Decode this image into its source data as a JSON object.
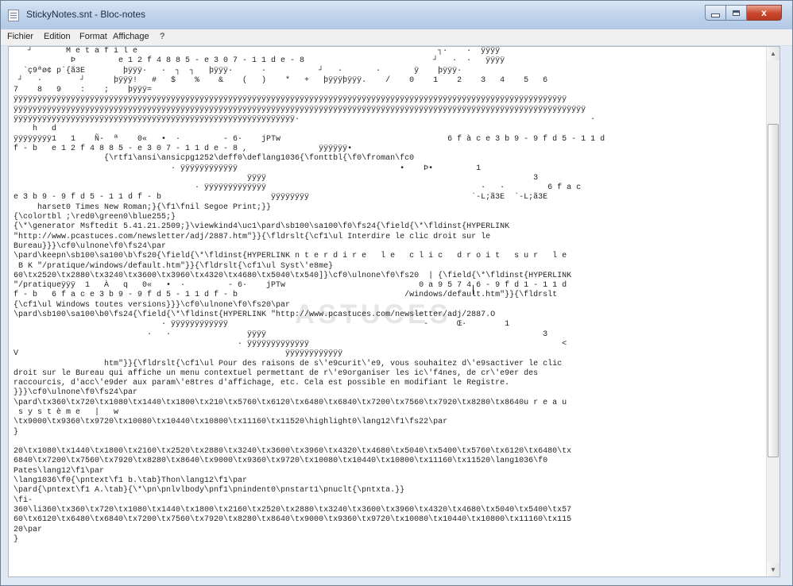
{
  "window": {
    "title": "StickyNotes.snt - Bloc-notes",
    "controls": {
      "minimize": "minimize",
      "maximize": "maximize",
      "close": "x"
    }
  },
  "menu": [
    "Fichier",
    "Edition",
    "Format",
    "Affichage",
    "?"
  ],
  "editor": {
    "watermark": "ASTUCES",
    "text": "   ┘       M e t a f i l e                                                               ┐·    ·  ÿÿÿÿ\n            Þ         e 1 2 f 4 8 8 5 - e 3 0 7 - 1 1 d e - 8                           ┘   ·  ·   ÿÿÿÿ\n  `ç9ªø¢ p`{ã3E        þÿÿÿ·   ·  ┐  ┐   þÿÿÿ·      ·           ┘   ·       ·       ÿ    þÿÿÿ·\n ┘   ·        ┘      þÿÿÿ!   #   $    %    &    (   )    *   +   þÿÿÿþÿÿÿ.    /    0    1    2    3   4    5   6\n7    8   9    :    ;    þÿÿÿ=\nÿÿÿÿÿÿÿÿÿÿÿÿÿÿÿÿÿÿÿÿÿÿÿÿÿÿÿÿÿÿÿÿÿÿÿÿÿÿÿÿÿÿÿÿÿÿÿÿÿÿÿÿÿÿÿÿÿÿÿÿÿÿÿÿÿÿÿÿÿÿÿÿÿÿÿÿÿÿÿÿÿÿÿÿÿÿÿÿÿÿÿÿÿÿÿÿÿÿÿÿÿÿÿÿÿÿÿÿÿÿÿÿÿÿÿÿ\nÿÿÿÿÿÿÿÿÿÿÿÿÿÿÿÿÿÿÿÿÿÿÿÿÿÿÿÿÿÿÿÿÿÿÿÿÿÿÿÿÿÿÿÿÿÿÿÿÿÿÿÿÿÿÿÿÿÿÿÿÿÿÿÿÿÿÿÿÿÿÿÿÿÿÿÿÿÿÿÿÿÿÿÿÿÿÿÿÿÿÿÿÿÿÿÿÿÿÿÿÿÿÿÿÿÿÿÿÿÿÿÿÿÿÿÿÿÿÿÿ\nÿÿÿÿÿÿÿÿÿÿÿÿÿÿÿÿÿÿÿÿÿÿÿÿÿÿÿÿÿÿÿÿÿÿÿÿÿÿÿÿÿÿÿÿÿÿÿÿÿÿÿÿÿÿÿÿÿÿÿ·                                                             ·\n    h   d\nÿÿÿÿÿÿÿÿ1   1    Ñ-  ª    0«   •  ·         - 6·    jPTw                                   6 f à c e 3 b 9 - 9 f d 5 - 1 1 d\nf - b   e 1 2 f 4 8 8 5 - e 3 0 7 - 1 1 d e - 8 ,               ÿÿÿÿÿÿ•\n                   {\\rtf1\\ansi\\ansicpg1252\\deff0\\deflang1036{\\fonttbl{\\f0\\froman\\fc0\n                                 · ÿÿÿÿÿÿÿÿÿÿÿÿ                                  •    Þ•         1\n                                                 ÿÿÿÿ                                                        3\n                                      · ÿÿÿÿÿÿÿÿÿÿÿÿÿ                                             ·   ·         6 f a c\ne 3 b 9 - 9 f d 5 - 1 1 d f - b                       ÿÿÿÿÿÿÿÿ                                  `-L;ã3E  `-L;ã3E\n     harset0 Times New Roman;}{\\f1\\fnil Segoe Print;}}\n{\\colortbl ;\\red0\\green0\\blue255;}\n{\\*\\generator Msftedit 5.41.21.2509;}\\viewkind4\\uc1\\pard\\sb100\\sa100\\f0\\fs24{\\field{\\*\\fldinst{HYPERLINK\n\"http://www.pcastuces.com/newsletter/adj/2887.htm\"}}{\\fldrslt{\\cf1\\ul Interdire le clic droit sur le\nBureau}}}\\cf0\\ulnone\\f0\\fs24\\par\n\\pard\\keepn\\sb100\\sa100\\b\\fs20{\\field{\\*\\fldinst{HYPERLINK n t e r d i r e   l e   c l i c   d r o i t   s u r   l e\n B K \"/pratique/windows/default.htm\"}}{\\fldrslt{\\cf1\\ul Syst\\'e8me}\n60\\tx2520\\tx2880\\tx3240\\tx3600\\tx3960\\tx4320\\tx4680\\tx5040\\tx540]}\\cf0\\ulnone\\f0\\fs20  | {\\field{\\*\\fldinst{HYPERLINK\n\"/pratiqueÿÿÿ  1   À   q   0«   •  ·         - 6·    jPTw                            0 a 9 5 7 4 6 - 9 f d 1 - 1 1 d\nf - b   6 f a c e 3 b 9 - 9 f d 5 - 1 1 d f - b                                   /windows/default.htm\"}}{\\fldrslt\n{\\cf1\\ul Windows toutes versions}}}\\cf0\\ulnone\\f0\\fs20\\par\n\\pard\\sb100\\sa100\\b0\\fs24{\\field{\\*\\fldinst{HYPERLINK \"http://www.pcastuces.com/newsletter/adj/2887.O\n                               · ÿÿÿÿÿÿÿÿÿÿÿÿ                                         -      Œ·        1\n                            ·   ·                ÿÿÿÿ                                                          3\n                                               · ÿÿÿÿÿÿÿÿÿÿÿÿÿ                                                     <\nV                                                        ÿÿÿÿÿÿÿÿÿÿÿÿ\n                   htm\"}}{\\fldrslt{\\cf1\\ul Pour des raisons de s\\'e9curit\\'e9, vous souhaitez d\\'e9sactiver le clic\ndroit sur le Bureau qui affiche un menu contextuel permettant de r\\'e9organiser les ic\\'f4nes, de cr\\'e9er des\nraccourcis, d'acc\\'e9der aux param\\'e8tres d'affichage, etc. Cela est possible en modifiant le Registre.\n}}}\\cf0\\ulnone\\f0\\fs24\\par\n\\pard\\tx360\\tx720\\tx1080\\tx1440\\tx1800\\tx210\\tx5760\\tx6120\\tx6480\\tx6840\\tx7200\\tx7560\\tx7920\\tx8280\\tx8640u r e a u\n s y s t è m e   |   w\n\\tx9000\\tx9360\\tx9720\\tx10080\\tx10440\\tx10800\\tx11160\\tx11520\\highlight0\\lang12\\f1\\fs22\\par\n}\n\n20\\tx1080\\tx1440\\tx1800\\tx2160\\tx2520\\tx2880\\tx3240\\tx3600\\tx3960\\tx4320\\tx4680\\tx5040\\tx5400\\tx5760\\tx6120\\tx6480\\tx\n6840\\tx7200\\tx7560\\tx7920\\tx8280\\tx8640\\tx9000\\tx9360\\tx9720\\tx10080\\tx10440\\tx10800\\tx11160\\tx11520\\lang1036\\f0\nPates\\lang12\\f1\\par\n\\lang1036\\f0{\\pntext\\f1 b.\\tab}Thon\\lang12\\f1\\par\n\\pard{\\pntext\\f1 A.\\tab}{\\*\\pn\\pnlvlbody\\pnf1\\pnindent0\\pnstart1\\pnuclt{\\pntxta.}}\n\\fi-\n360\\li360\\tx360\\tx720\\tx1080\\tx1440\\tx1800\\tx2160\\tx2520\\tx2880\\tx3240\\tx3600\\tx3960\\tx4320\\tx4680\\tx5040\\tx5400\\tx57\n60\\tx6120\\tx6480\\tx6840\\tx7200\\tx7560\\tx7920\\tx8280\\tx8640\\tx9000\\tx9360\\tx9720\\tx10080\\tx10440\\tx10800\\tx11160\\tx115\n20\\par\n}"
  },
  "scrollbar": {
    "up_arrow": "▲",
    "down_arrow": "▼"
  }
}
